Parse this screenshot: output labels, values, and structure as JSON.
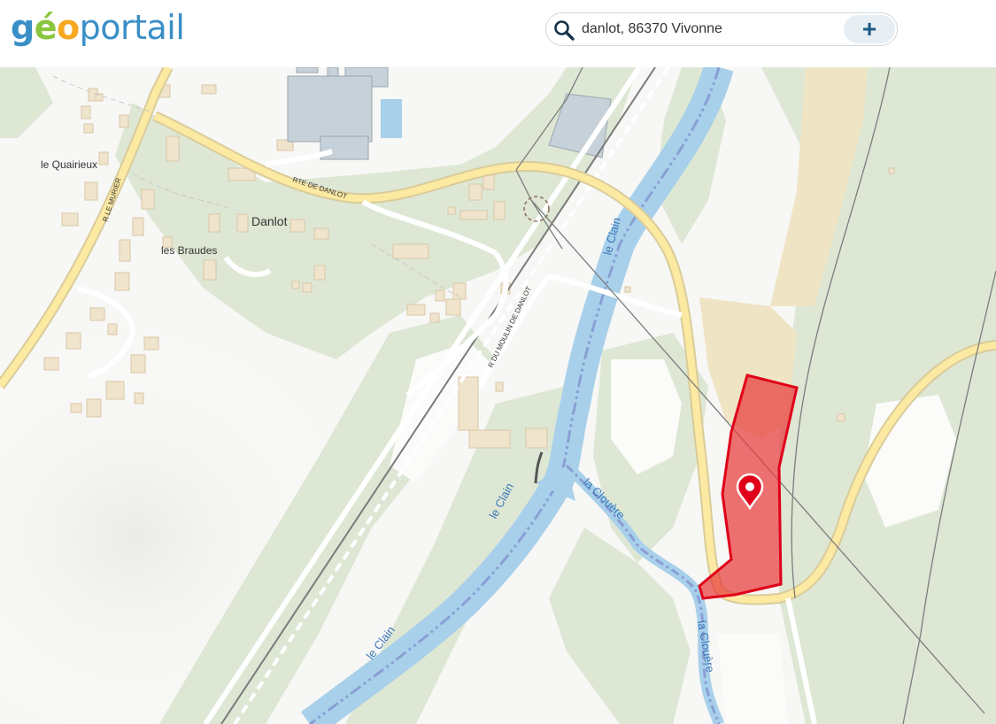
{
  "logo": {
    "part_g": "g",
    "part_e": "é",
    "part_o": "o",
    "part_rest": "portail"
  },
  "search": {
    "value": "danlot, 86370 Vivonne",
    "add_label": "+"
  },
  "icons": {
    "search": "search-icon",
    "add": "plus-icon",
    "marker": "map-pin-icon"
  },
  "colors": {
    "parcel_fill": "#e63c3c",
    "parcel_stroke": "#e0001a",
    "water": "#a8d0ea",
    "road": "#fce9a2"
  },
  "map": {
    "places": {
      "danlot": "Danlot",
      "quairieux": "le Quairieux",
      "braudes": "les Braudes"
    },
    "roads": {
      "danlot_road": "RTE DE DANLOT",
      "murier": "R LE MURIER",
      "moulin": "R DU MOULIN DE DANLOT"
    },
    "water": {
      "clain_1": "le Clain",
      "clain_2": "le Clain",
      "clain_3": "le Clain",
      "clouere_1": "la Clouère",
      "clouere_2": "la Clouère"
    }
  }
}
